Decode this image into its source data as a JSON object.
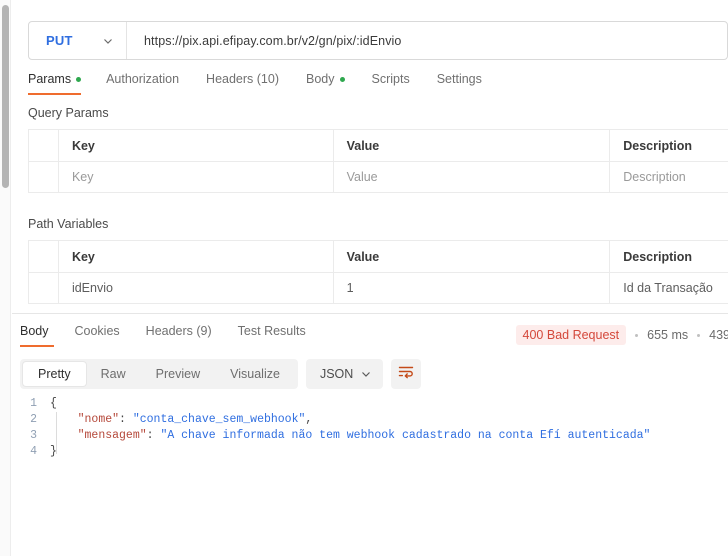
{
  "request": {
    "method": "PUT",
    "method_dropdown_icon": "chevron-down-icon",
    "url_base": "https://pix.api.efipay.com.br/v2/gn/pix/",
    "url_pathvar": ":idEnvio",
    "tabs": [
      {
        "label": "Params",
        "dot": true,
        "active": true
      },
      {
        "label": "Authorization",
        "dot": false,
        "active": false
      },
      {
        "label": "Headers (10)",
        "dot": false,
        "active": false
      },
      {
        "label": "Body",
        "dot": true,
        "active": false
      },
      {
        "label": "Scripts",
        "dot": false,
        "active": false
      },
      {
        "label": "Settings",
        "dot": false,
        "active": false
      }
    ],
    "query_params": {
      "section_label": "Query Params",
      "columns": [
        "Key",
        "Value",
        "Description"
      ],
      "rows": [
        {
          "key": "Key",
          "value": "Value",
          "description": "Description",
          "placeholder": true
        }
      ]
    },
    "path_variables": {
      "section_label": "Path Variables",
      "columns": [
        "Key",
        "Value",
        "Description"
      ],
      "rows": [
        {
          "key": "idEnvio",
          "value": "1",
          "description": "Id da Transação",
          "placeholder": false
        }
      ]
    }
  },
  "response": {
    "tabs": [
      {
        "label": "Body",
        "active": true
      },
      {
        "label": "Cookies",
        "active": false
      },
      {
        "label": "Headers (9)",
        "active": false
      },
      {
        "label": "Test Results",
        "active": false
      }
    ],
    "status": {
      "code_text": "400 Bad Request",
      "time": "655 ms",
      "size": "439",
      "badge_color": "#d4483b",
      "badge_bg": "#fdeceb"
    },
    "toolbar": {
      "views": [
        {
          "label": "Pretty",
          "active": true
        },
        {
          "label": "Raw",
          "active": false
        },
        {
          "label": "Preview",
          "active": false
        },
        {
          "label": "Visualize",
          "active": false
        }
      ],
      "format": "JSON",
      "format_dropdown_icon": "chevron-down-icon",
      "wrap_button_icon": "word-wrap-icon"
    },
    "body_lines": [
      {
        "num": "1",
        "code": "{"
      },
      {
        "num": "2",
        "code": "    \"nome\": \"conta_chave_sem_webhook\","
      },
      {
        "num": "3",
        "code": "    \"mensagem\": \"A chave informada não tem webhook cadastrado na conta Efí autenticada\""
      },
      {
        "num": "4",
        "code": "}"
      }
    ],
    "body_json": {
      "nome": "conta_chave_sem_webhook",
      "mensagem": "A chave informada não tem webhook cadastrado na conta Efí autenticada"
    }
  }
}
